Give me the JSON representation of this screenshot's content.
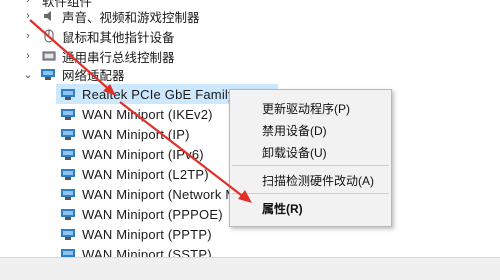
{
  "tree": {
    "top_partial": "软件组件",
    "categories": [
      {
        "label": "声音、视频和游戏控制器",
        "icon": "speaker-icon",
        "expanded": false
      },
      {
        "label": "鼠标和其他指针设备",
        "icon": "mouse-icon",
        "expanded": false
      },
      {
        "label": "通用串行总线控制器",
        "icon": "usb-controller-icon",
        "expanded": false
      },
      {
        "label": "网络适配器",
        "icon": "network-adapter-icon",
        "expanded": true
      }
    ],
    "adapters": [
      "Realtek PCIe GbE Family Controller",
      "WAN Miniport (IKEv2)",
      "WAN Miniport (IP)",
      "WAN Miniport (IPv6)",
      "WAN Miniport (L2TP)",
      "WAN Miniport (Network Monitor)",
      "WAN Miniport (PPPOE)",
      "WAN Miniport (PPTP)",
      "WAN Miniport (SSTP)"
    ]
  },
  "context_menu": {
    "update_driver": "更新驱动程序(P)",
    "disable_device": "禁用设备(D)",
    "uninstall_device": "卸载设备(U)",
    "scan_hardware": "扫描检测硬件改动(A)",
    "properties": "属性(R)"
  },
  "colors": {
    "selection": "#cce8ff",
    "annotation_arrow": "#e0302a",
    "adapter_icon": "#2f7fc8"
  }
}
